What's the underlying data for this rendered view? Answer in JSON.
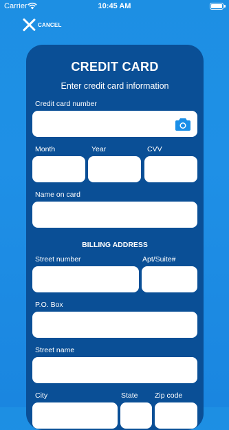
{
  "status_bar": {
    "carrier": "Carrier",
    "time": "10:45 AM"
  },
  "header": {
    "cancel_label": "CANCEL"
  },
  "form": {
    "title": "CREDIT CARD",
    "subtitle": "Enter credit card information",
    "card_number_label": "Credit card number",
    "month_label": "Month",
    "year_label": "Year",
    "cvv_label": "CVV",
    "name_label": "Name on card",
    "billing_heading": "BILLING ADDRESS",
    "street_number_label": "Street number",
    "apt_label": "Apt/Suite#",
    "po_box_label": "P.O. Box",
    "street_name_label": "Street name",
    "city_label": "City",
    "state_label": "State",
    "zip_label": "Zip code"
  },
  "colors": {
    "background": "#1d8fe3",
    "panel": "#0a4f96",
    "accent": "#1a8fe8",
    "field": "#ffffff"
  },
  "icons": [
    "wifi-icon",
    "battery-icon",
    "close-icon",
    "camera-icon"
  ]
}
